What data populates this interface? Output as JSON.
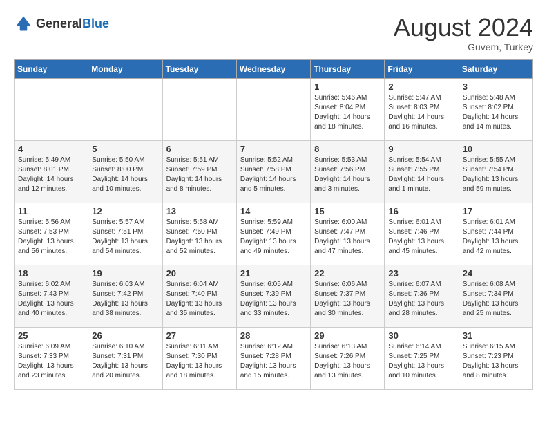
{
  "logo": {
    "general": "General",
    "blue": "Blue"
  },
  "header": {
    "title": "August 2024",
    "subtitle": "Guvem, Turkey"
  },
  "weekdays": [
    "Sunday",
    "Monday",
    "Tuesday",
    "Wednesday",
    "Thursday",
    "Friday",
    "Saturday"
  ],
  "weeks": [
    [
      {
        "day": "",
        "content": ""
      },
      {
        "day": "",
        "content": ""
      },
      {
        "day": "",
        "content": ""
      },
      {
        "day": "",
        "content": ""
      },
      {
        "day": "1",
        "content": "Sunrise: 5:46 AM\nSunset: 8:04 PM\nDaylight: 14 hours\nand 18 minutes."
      },
      {
        "day": "2",
        "content": "Sunrise: 5:47 AM\nSunset: 8:03 PM\nDaylight: 14 hours\nand 16 minutes."
      },
      {
        "day": "3",
        "content": "Sunrise: 5:48 AM\nSunset: 8:02 PM\nDaylight: 14 hours\nand 14 minutes."
      }
    ],
    [
      {
        "day": "4",
        "content": "Sunrise: 5:49 AM\nSunset: 8:01 PM\nDaylight: 14 hours\nand 12 minutes."
      },
      {
        "day": "5",
        "content": "Sunrise: 5:50 AM\nSunset: 8:00 PM\nDaylight: 14 hours\nand 10 minutes."
      },
      {
        "day": "6",
        "content": "Sunrise: 5:51 AM\nSunset: 7:59 PM\nDaylight: 14 hours\nand 8 minutes."
      },
      {
        "day": "7",
        "content": "Sunrise: 5:52 AM\nSunset: 7:58 PM\nDaylight: 14 hours\nand 5 minutes."
      },
      {
        "day": "8",
        "content": "Sunrise: 5:53 AM\nSunset: 7:56 PM\nDaylight: 14 hours\nand 3 minutes."
      },
      {
        "day": "9",
        "content": "Sunrise: 5:54 AM\nSunset: 7:55 PM\nDaylight: 14 hours\nand 1 minute."
      },
      {
        "day": "10",
        "content": "Sunrise: 5:55 AM\nSunset: 7:54 PM\nDaylight: 13 hours\nand 59 minutes."
      }
    ],
    [
      {
        "day": "11",
        "content": "Sunrise: 5:56 AM\nSunset: 7:53 PM\nDaylight: 13 hours\nand 56 minutes."
      },
      {
        "day": "12",
        "content": "Sunrise: 5:57 AM\nSunset: 7:51 PM\nDaylight: 13 hours\nand 54 minutes."
      },
      {
        "day": "13",
        "content": "Sunrise: 5:58 AM\nSunset: 7:50 PM\nDaylight: 13 hours\nand 52 minutes."
      },
      {
        "day": "14",
        "content": "Sunrise: 5:59 AM\nSunset: 7:49 PM\nDaylight: 13 hours\nand 49 minutes."
      },
      {
        "day": "15",
        "content": "Sunrise: 6:00 AM\nSunset: 7:47 PM\nDaylight: 13 hours\nand 47 minutes."
      },
      {
        "day": "16",
        "content": "Sunrise: 6:01 AM\nSunset: 7:46 PM\nDaylight: 13 hours\nand 45 minutes."
      },
      {
        "day": "17",
        "content": "Sunrise: 6:01 AM\nSunset: 7:44 PM\nDaylight: 13 hours\nand 42 minutes."
      }
    ],
    [
      {
        "day": "18",
        "content": "Sunrise: 6:02 AM\nSunset: 7:43 PM\nDaylight: 13 hours\nand 40 minutes."
      },
      {
        "day": "19",
        "content": "Sunrise: 6:03 AM\nSunset: 7:42 PM\nDaylight: 13 hours\nand 38 minutes."
      },
      {
        "day": "20",
        "content": "Sunrise: 6:04 AM\nSunset: 7:40 PM\nDaylight: 13 hours\nand 35 minutes."
      },
      {
        "day": "21",
        "content": "Sunrise: 6:05 AM\nSunset: 7:39 PM\nDaylight: 13 hours\nand 33 minutes."
      },
      {
        "day": "22",
        "content": "Sunrise: 6:06 AM\nSunset: 7:37 PM\nDaylight: 13 hours\nand 30 minutes."
      },
      {
        "day": "23",
        "content": "Sunrise: 6:07 AM\nSunset: 7:36 PM\nDaylight: 13 hours\nand 28 minutes."
      },
      {
        "day": "24",
        "content": "Sunrise: 6:08 AM\nSunset: 7:34 PM\nDaylight: 13 hours\nand 25 minutes."
      }
    ],
    [
      {
        "day": "25",
        "content": "Sunrise: 6:09 AM\nSunset: 7:33 PM\nDaylight: 13 hours\nand 23 minutes."
      },
      {
        "day": "26",
        "content": "Sunrise: 6:10 AM\nSunset: 7:31 PM\nDaylight: 13 hours\nand 20 minutes."
      },
      {
        "day": "27",
        "content": "Sunrise: 6:11 AM\nSunset: 7:30 PM\nDaylight: 13 hours\nand 18 minutes."
      },
      {
        "day": "28",
        "content": "Sunrise: 6:12 AM\nSunset: 7:28 PM\nDaylight: 13 hours\nand 15 minutes."
      },
      {
        "day": "29",
        "content": "Sunrise: 6:13 AM\nSunset: 7:26 PM\nDaylight: 13 hours\nand 13 minutes."
      },
      {
        "day": "30",
        "content": "Sunrise: 6:14 AM\nSunset: 7:25 PM\nDaylight: 13 hours\nand 10 minutes."
      },
      {
        "day": "31",
        "content": "Sunrise: 6:15 AM\nSunset: 7:23 PM\nDaylight: 13 hours\nand 8 minutes."
      }
    ]
  ]
}
